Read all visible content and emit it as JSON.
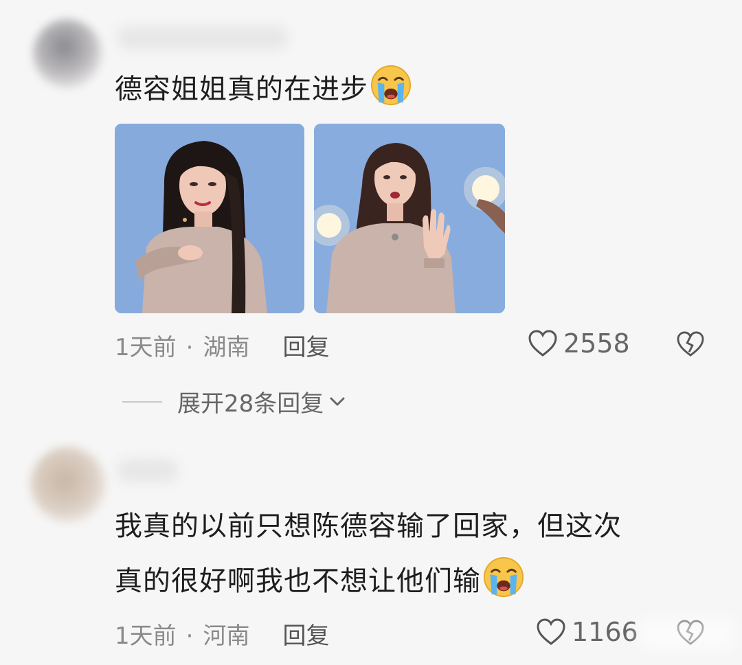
{
  "comments": [
    {
      "text": "德容姐姐真的在进步",
      "emoji": "loudly-crying-face",
      "time": "1天前",
      "location": "湖南",
      "reply_label": "回复",
      "likes": "2558",
      "photos": [
        "stage photo of performer reaching forward",
        "stage photo of performer singing with raised hand"
      ]
    },
    {
      "text_line1": "我真的以前只想陈德容输了回家，但这次",
      "text_line2": "真的很好啊我也不想让他们输",
      "emoji": "loudly-crying-face",
      "time": "1天前",
      "location": "河南",
      "reply_label": "回复",
      "likes": "1166"
    }
  ],
  "expand_replies": "展开28条回复",
  "separator_dot": "·",
  "colors": {
    "background": "#f6f6f6",
    "text": "#1e1e1e",
    "meta": "#8a8a8a",
    "photo_bg": "#7ea4d8"
  }
}
